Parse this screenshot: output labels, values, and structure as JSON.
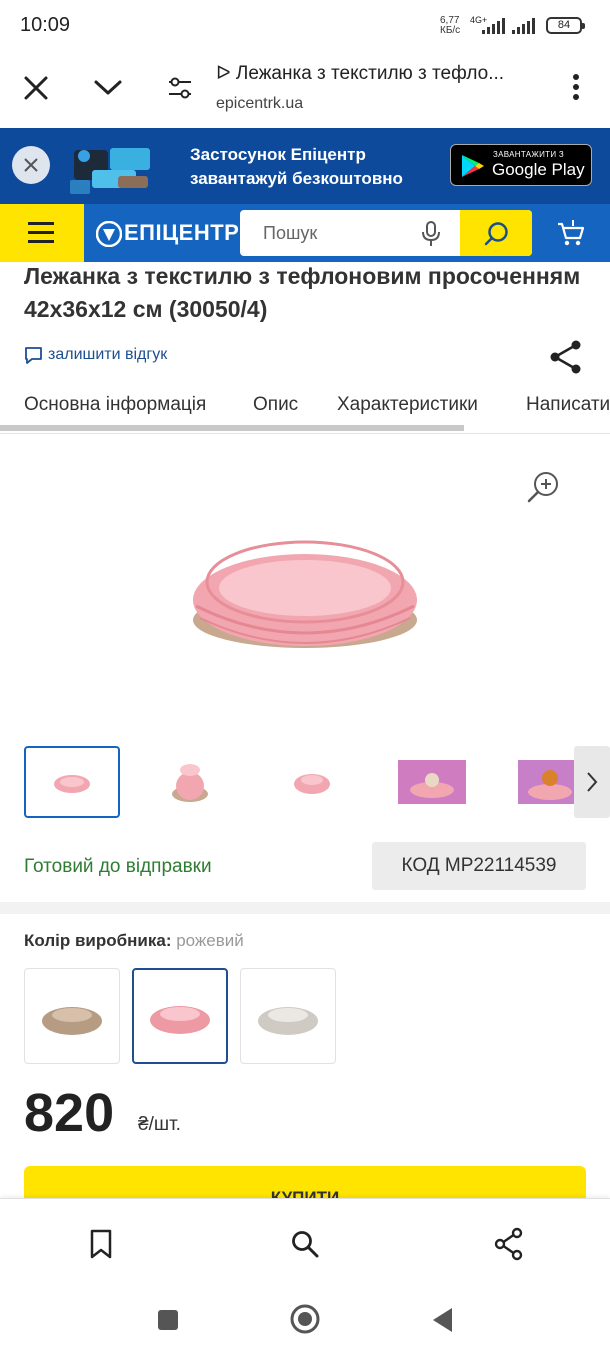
{
  "status_bar": {
    "time": "10:09",
    "net_speed": "6,77",
    "net_unit": "КБ/с",
    "net_type": "4G+",
    "battery": "84"
  },
  "browser": {
    "page_title": "ᐅ Лежанка з текстилю з тефло...",
    "url": "epicentrk.ua"
  },
  "promo": {
    "line1": "Застосунок Епіцентр",
    "line2": "завантажуй безкоштовно",
    "store_small": "ЗАВАНТАЖИТИ З",
    "store_big": "Google Play"
  },
  "header": {
    "logo": "ЕПІЦЕНТР",
    "search_placeholder": "Пошук",
    "brand_color": "#1565c0",
    "accent_color": "#ffe400"
  },
  "product": {
    "title": "Лежанка з текстилю з тефлоновим просоченням 42х36х12 см (30050/4)",
    "review_link": "залишити відгук",
    "tabs": [
      "Основна інформація",
      "Опис",
      "Характеристики",
      "Написати"
    ],
    "status": "Готовий до відправки",
    "code": "КОД MP22114539",
    "color_label": "Колір виробника:",
    "color_value": "рожевий",
    "colors": [
      "beige",
      "pink",
      "grey"
    ],
    "price": "820",
    "price_unit": "₴/шт.",
    "buy_label": "КУПИТИ",
    "status_color": "#2e7d32"
  },
  "icons": {
    "close": "close-icon",
    "chevron": "chevron-down-icon",
    "tune": "tune-icon",
    "more": "more-vert-icon",
    "zoom": "zoom-in-icon",
    "share": "share-icon",
    "bookmark": "bookmark-icon",
    "search": "search-icon",
    "cart": "cart-icon",
    "mic": "mic-icon"
  }
}
